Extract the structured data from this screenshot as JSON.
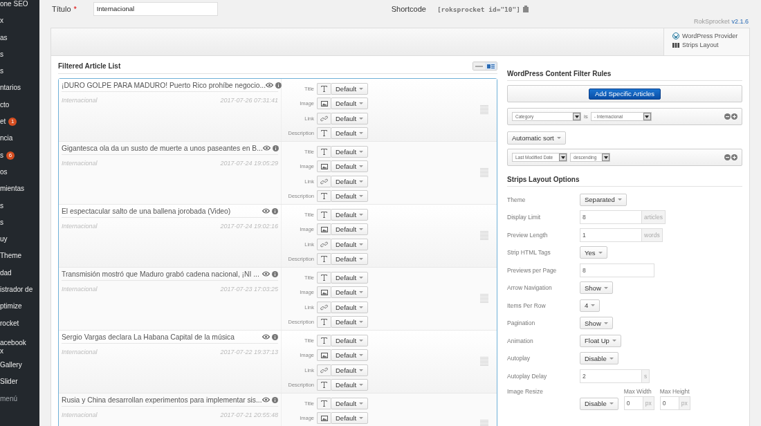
{
  "sidebar": {
    "items": [
      {
        "label": "one SEO"
      },
      {
        "label": "x"
      },
      {
        "label": "as"
      },
      {
        "label": "s"
      },
      {
        "label": "s"
      },
      {
        "label": "ntarios"
      },
      {
        "label": "cto"
      },
      {
        "label": "et",
        "badge": "1"
      },
      {
        "label": "ncia"
      },
      {
        "label": "s",
        "badge": "6"
      },
      {
        "label": "os"
      },
      {
        "label": "mientas"
      },
      {
        "label": "s"
      },
      {
        "label": "s"
      },
      {
        "label": "uy"
      },
      {
        "label": "Theme"
      },
      {
        "label": "dad"
      },
      {
        "label": "istrador de"
      },
      {
        "label": "ptimize"
      },
      {
        "label": "rocket"
      },
      {
        "label": "acebook",
        "line2": "x"
      },
      {
        "label": "Gallery"
      },
      {
        "label": "Slider"
      },
      {
        "label": "menú",
        "kind": "collapse"
      }
    ]
  },
  "title_field": {
    "label": "Título",
    "required": "*",
    "value": "Internacional"
  },
  "shortcode": {
    "label": "Shortcode",
    "value": "[roksprocket id=\"10\"]"
  },
  "version": {
    "name": "RokSprocket",
    "number": "v2.1.6"
  },
  "provider": {
    "provider": "WordPress Provider",
    "layout": "Strips Layout"
  },
  "article_list": {
    "title": "Filtered Article List",
    "view_toggle": [
      {
        "selected": false
      },
      {
        "selected": true
      }
    ],
    "articles": [
      {
        "title": "¡DURO GOLPE PARA MADURO! Puerto Rico prohíbe negocio...",
        "category": "Internacional",
        "date": "2017-07-26 07:31:41",
        "options": [
          {
            "label": "Title",
            "kind": "text",
            "value": "Default"
          },
          {
            "label": "Image",
            "kind": "image",
            "value": "Default"
          },
          {
            "label": "Link",
            "kind": "link",
            "value": "Default"
          },
          {
            "label": "Description",
            "kind": "text",
            "value": "Default"
          }
        ]
      },
      {
        "title": "Gigantesca ola da un susto de muerte a unos paseantes en B...",
        "category": "Internacional",
        "date": "2017-07-24 19:05:29",
        "options": [
          {
            "label": "Title",
            "kind": "text",
            "value": "Default"
          },
          {
            "label": "Image",
            "kind": "image",
            "value": "Default"
          },
          {
            "label": "Link",
            "kind": "link",
            "value": "Default"
          },
          {
            "label": "Description",
            "kind": "text",
            "value": "Default"
          }
        ]
      },
      {
        "title": "El espectacular salto de una ballena jorobada (Video)",
        "category": "Internacional",
        "date": "2017-07-24 19:02:16",
        "options": [
          {
            "label": "Title",
            "kind": "text",
            "value": "Default"
          },
          {
            "label": "Image",
            "kind": "image",
            "value": "Default"
          },
          {
            "label": "Link",
            "kind": "link",
            "value": "Default"
          },
          {
            "label": "Description",
            "kind": "text",
            "value": "Default"
          }
        ]
      },
      {
        "title": "Transmisión mostró que Maduro grabó cadena nacional, ¡NI ...",
        "category": "Internacional",
        "date": "2017-07-23 17:03:25",
        "options": [
          {
            "label": "Title",
            "kind": "text",
            "value": "Default"
          },
          {
            "label": "Image",
            "kind": "image",
            "value": "Default"
          },
          {
            "label": "Link",
            "kind": "link",
            "value": "Default"
          },
          {
            "label": "Description",
            "kind": "text",
            "value": "Default"
          }
        ]
      },
      {
        "title": "Sergio Vargas declara La Habana Capital de la música",
        "category": "Internacional",
        "date": "2017-07-22 19:37:13",
        "options": [
          {
            "label": "Title",
            "kind": "text",
            "value": "Default"
          },
          {
            "label": "Image",
            "kind": "image",
            "value": "Default"
          },
          {
            "label": "Link",
            "kind": "link",
            "value": "Default"
          },
          {
            "label": "Description",
            "kind": "text",
            "value": "Default"
          }
        ]
      },
      {
        "title": "Rusia y China desarrollan experimentos para implementar sis...",
        "category": "Internacional",
        "date": "2017-07-21 20:55:48",
        "options": [
          {
            "label": "Title",
            "kind": "text",
            "value": "Default"
          },
          {
            "label": "Image",
            "kind": "image",
            "value": "Default"
          }
        ]
      }
    ]
  },
  "filter_rules": {
    "title": "WordPress Content Filter Rules",
    "add_button": "Add Specific Articles",
    "rule": {
      "field": "Category",
      "operator": "is",
      "value": "- Internacional"
    },
    "sort_button": "Automatic sort",
    "sort_rule": {
      "field": "Last Modified Date",
      "direction": "descending"
    }
  },
  "layout_options": {
    "title": "Strips Layout Options",
    "rows": [
      {
        "label": "Theme",
        "kind": "dropdown",
        "value": "Separated"
      },
      {
        "label": "Display Limit",
        "kind": "input",
        "value": "8",
        "unit": "articles"
      },
      {
        "label": "Preview Length",
        "kind": "input",
        "value": "1",
        "unit": "words"
      },
      {
        "label": "Strip HTML Tags",
        "kind": "dropdown",
        "value": "Yes"
      },
      {
        "label": "Previews per Page",
        "kind": "input",
        "value": "8"
      },
      {
        "label": "Arrow Navigation",
        "kind": "dropdown",
        "value": "Show"
      },
      {
        "label": "Items Per Row",
        "kind": "dropdown",
        "value": "4"
      },
      {
        "label": "Pagination",
        "kind": "dropdown",
        "value": "Show"
      },
      {
        "label": "Animation",
        "kind": "dropdown",
        "value": "Float Up"
      },
      {
        "label": "Autoplay",
        "kind": "dropdown",
        "value": "Disable"
      },
      {
        "label": "Autoplay Delay",
        "kind": "input",
        "value": "2",
        "unit": "s"
      },
      {
        "label": "Image Resize",
        "kind": "resize",
        "value": "Disable",
        "sizes": [
          {
            "label": "Max Width",
            "value": "0",
            "unit": "px"
          },
          {
            "label": "Max Height",
            "value": "0",
            "unit": "px"
          }
        ]
      }
    ]
  }
}
